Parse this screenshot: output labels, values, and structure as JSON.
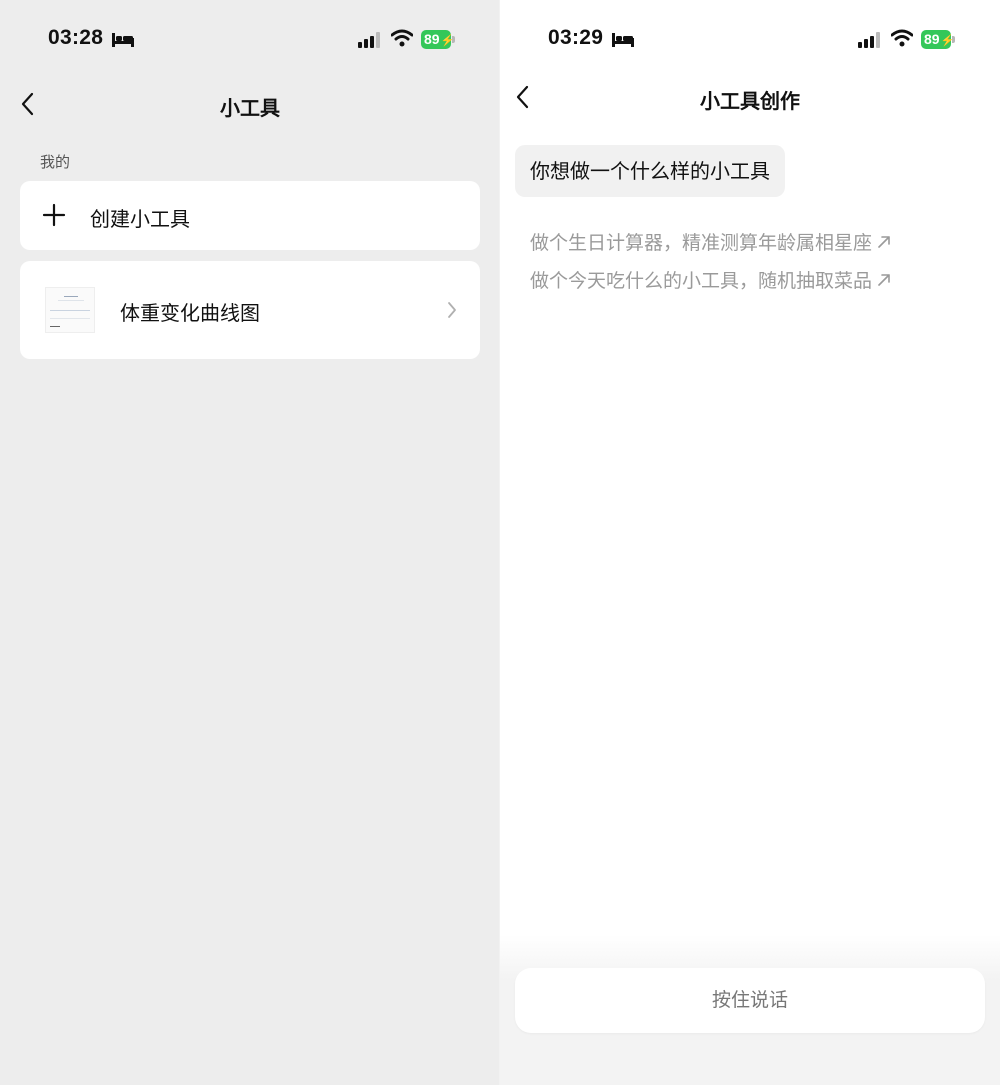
{
  "left": {
    "status": {
      "time": "03:28",
      "battery": "89"
    },
    "title": "小工具",
    "section_label": "我的",
    "create_label": "创建小工具",
    "tool_name": "体重变化曲线图"
  },
  "right": {
    "status": {
      "time": "03:29",
      "battery": "89"
    },
    "title": "小工具创作",
    "prompt": "你想做一个什么样的小工具",
    "suggestions": [
      "做个生日计算器，精准测算年龄属相星座",
      "做个今天吃什么的小工具，随机抽取菜品"
    ],
    "voice_button": "按住说话"
  },
  "icons": [
    "bed-icon",
    "signal-icon",
    "wifi-icon",
    "battery-icon",
    "back-icon",
    "plus-icon",
    "chevron-right-icon",
    "arrow-up-right-icon"
  ],
  "colors": {
    "battery_green": "#34c759",
    "left_background": "#ededed",
    "card": "#ffffff",
    "hint_gray": "#9a9a9a",
    "bubble": "#f1f1f1"
  }
}
